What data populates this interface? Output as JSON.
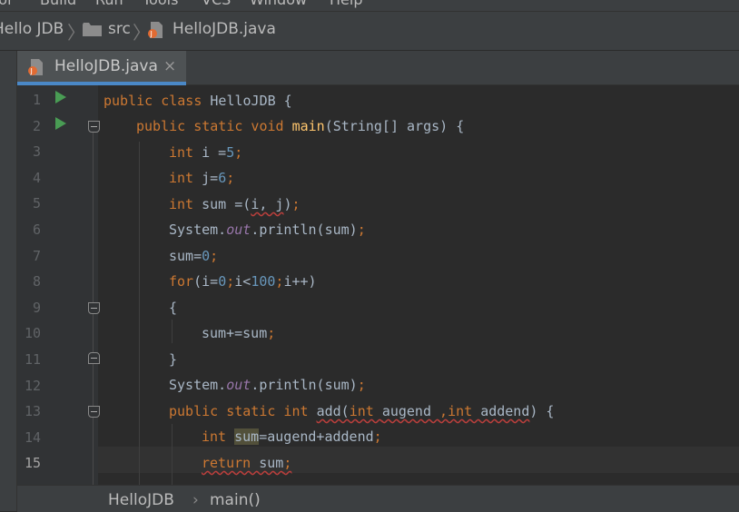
{
  "menu": {
    "items": [
      "tor",
      "Build",
      "Run",
      "Tools",
      "VCS",
      "Window",
      "Help"
    ]
  },
  "breadcrumb": [
    "Hello JDB",
    "src",
    "HelloJDB.java"
  ],
  "tab": {
    "label": "HelloJDB.java",
    "close": "×"
  },
  "editor": {
    "current_line": 15,
    "lines": [
      {
        "n": "1"
      },
      {
        "n": "2"
      },
      {
        "n": "3"
      },
      {
        "n": "4"
      },
      {
        "n": "5"
      },
      {
        "n": "6"
      },
      {
        "n": "7"
      },
      {
        "n": "8"
      },
      {
        "n": "9"
      },
      {
        "n": "10"
      },
      {
        "n": "11"
      },
      {
        "n": "12"
      },
      {
        "n": "13"
      },
      {
        "n": "14"
      },
      {
        "n": "15"
      }
    ],
    "tokens": {
      "l1": [
        "public class ",
        "HelloJDB",
        " {"
      ],
      "l2": [
        "public static void ",
        "main",
        "(String[] args) {"
      ],
      "l3": [
        "int ",
        "i =",
        "5",
        ";"
      ],
      "l4": [
        "int ",
        "j",
        "=",
        "6",
        ";"
      ],
      "l5": [
        "int ",
        "sum =(",
        "i, j",
        ")",
        ";"
      ],
      "l6": [
        "System.",
        "out",
        ".println(sum)",
        ";"
      ],
      "l7": [
        "sum=",
        "0",
        ";"
      ],
      "l8": [
        "for",
        "(i=",
        "0",
        ";",
        "i<",
        "100",
        ";",
        "i++)"
      ],
      "l9": [
        "{"
      ],
      "l10": [
        "sum+=sum",
        ";"
      ],
      "l11": [
        "}"
      ],
      "l12": [
        "System.",
        "out",
        ".println(sum)",
        ";"
      ],
      "l13": [
        "public static int ",
        "add",
        "(",
        "int ",
        "augend",
        " ,",
        "int ",
        "addend",
        ") {"
      ],
      "l14": [
        "int ",
        "sum",
        "=augend+addend",
        ";"
      ],
      "l15": [
        "return ",
        "sum",
        ";"
      ]
    }
  },
  "status": {
    "class": "HelloJDB",
    "sep": "›",
    "method": "main()"
  },
  "colors": {
    "keyword": "#cc7832",
    "number": "#6897bb",
    "function": "#ffc66d",
    "static_field": "#9876aa",
    "run_icon": "#499c54",
    "tab_underline": "#4a88c7"
  }
}
